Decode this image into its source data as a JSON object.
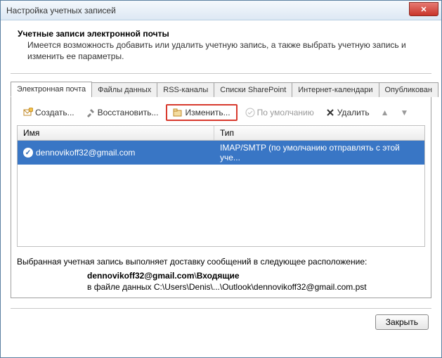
{
  "window": {
    "title": "Настройка учетных записей"
  },
  "heading": {
    "title": "Учетные записи электронной почты",
    "desc": "Имеется возможность добавить или удалить учетную запись, а также выбрать учетную запись и изменить ее параметры."
  },
  "tabs": [
    {
      "label": "Электронная почта",
      "active": true
    },
    {
      "label": "Файлы данных",
      "active": false
    },
    {
      "label": "RSS-каналы",
      "active": false
    },
    {
      "label": "Списки SharePoint",
      "active": false
    },
    {
      "label": "Интернет-календари",
      "active": false
    },
    {
      "label": "Опубликован",
      "active": false
    }
  ],
  "toolbar": {
    "create": "Создать...",
    "repair": "Восстановить...",
    "change": "Изменить...",
    "default": "По умолчанию",
    "delete": "Удалить"
  },
  "list": {
    "headers": {
      "name": "Имя",
      "type": "Тип"
    },
    "rows": [
      {
        "name": "dennovikoff32@gmail.com",
        "type": "IMAP/SMTP (по умолчанию отправлять с этой уче..."
      }
    ]
  },
  "delivery": {
    "intro": "Выбранная учетная запись выполняет доставку сообщений в следующее расположение:",
    "account": "dennovikoff32@gmail.com",
    "folder_sep": "\\",
    "folder": "Входящие",
    "path_prefix": "в файле данных ",
    "path": "C:\\Users\\Denis\\...\\Outlook\\dennovikoff32@gmail.com.pst"
  },
  "footer": {
    "close": "Закрыть"
  }
}
